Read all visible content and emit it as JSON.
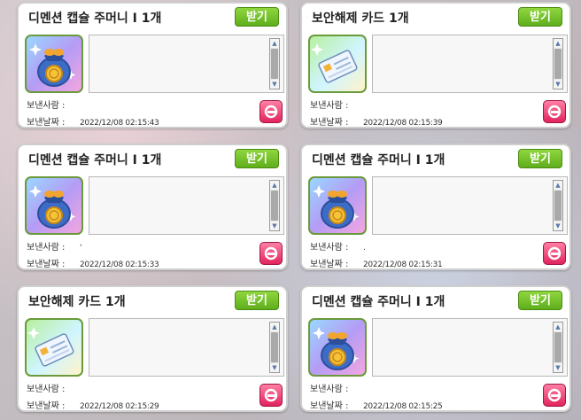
{
  "labels": {
    "receive": "받기",
    "sender": "보낸사람 :",
    "date": "보낸날짜 :"
  },
  "items": [
    {
      "title": "디멘션 캡슐 주머니 I 1개",
      "icon": "pouch-icon",
      "sender": "",
      "date": "2022/12/08 02:15:43"
    },
    {
      "title": "보안해제 카드 1개",
      "icon": "card-icon",
      "sender": "",
      "date": "2022/12/08 02:15:39"
    },
    {
      "title": "디멘션 캡슐 주머니 I 1개",
      "icon": "pouch-icon",
      "sender": "'",
      "date": "2022/12/08 02:15:33"
    },
    {
      "title": "디멘션 캡슐 주머니 I 1개",
      "icon": "pouch-icon",
      "sender": ".",
      "date": "2022/12/08 02:15:31"
    },
    {
      "title": "보안해제 카드 1개",
      "icon": "card-icon",
      "sender": "",
      "date": "2022/12/08 02:15:29"
    },
    {
      "title": "디멘션 캡슐 주머니 I 1개",
      "icon": "pouch-icon",
      "sender": "",
      "date": "2022/12/08 02:15:25"
    }
  ],
  "colors": {
    "receive_button": "#6fbf28",
    "delete_button": "#e1245e",
    "frame": "#6a9a3a"
  }
}
